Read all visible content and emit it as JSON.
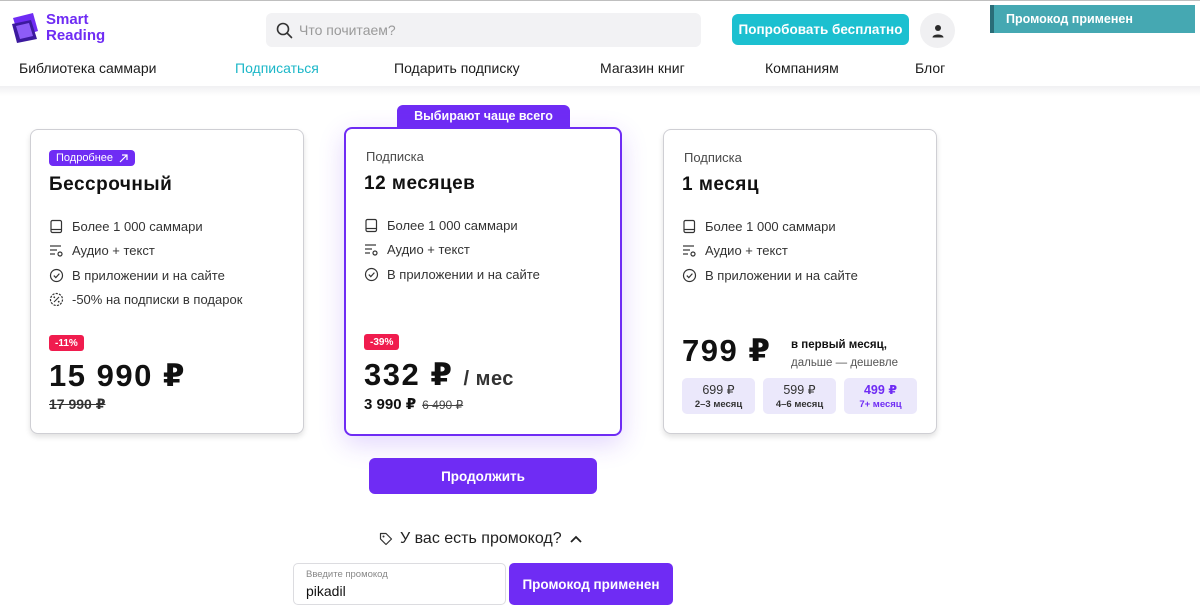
{
  "logo": {
    "line1": "Smart",
    "line2": "Reading"
  },
  "search": {
    "placeholder": "Что почитаем?",
    "icon": "search-icon"
  },
  "header": {
    "try_free_label": "Попробовать бесплатно",
    "user_icon": "user-icon"
  },
  "toast": {
    "text": "Промокод применен"
  },
  "nav": {
    "items": [
      {
        "label": "Библиотека саммари"
      },
      {
        "label": "Подписаться",
        "active": true
      },
      {
        "label": "Подарить подписку"
      },
      {
        "label": "Магазин книг"
      },
      {
        "label": "Компаниям"
      },
      {
        "label": "Блог"
      }
    ]
  },
  "plans": [
    {
      "tag": "Подробнее",
      "name": "Бессрочный",
      "features": [
        {
          "icon": "book-icon",
          "text": "Более 1 000 саммари"
        },
        {
          "icon": "audio-text-icon",
          "text": "Аудио + текст"
        },
        {
          "icon": "check-circle-icon",
          "text": "В приложении и на сайте"
        },
        {
          "icon": "discount-badge-icon",
          "text": "-50% на подписки в подарок"
        }
      ],
      "discount": "-11%",
      "price": "15 990 ₽",
      "old_price": "17 990 ₽"
    },
    {
      "badge": "Выбирают чаще всего",
      "kind": "Подписка",
      "name": "12 месяцев",
      "features": [
        {
          "icon": "book-icon",
          "text": "Более 1 000 саммари"
        },
        {
          "icon": "audio-text-icon",
          "text": "Аудио + текст"
        },
        {
          "icon": "check-circle-icon",
          "text": "В приложении и на сайте"
        }
      ],
      "discount": "-39%",
      "price": "332 ₽",
      "per": "/ мес",
      "total": "3 990 ₽",
      "old_total": "6 490 ₽"
    },
    {
      "kind": "Подписка",
      "name": "1 месяц",
      "features": [
        {
          "icon": "book-icon",
          "text": "Более 1 000 саммари"
        },
        {
          "icon": "audio-text-icon",
          "text": "Аудио + текст"
        },
        {
          "icon": "check-circle-icon",
          "text": "В приложении и на сайте"
        }
      ],
      "price": "799 ₽",
      "first_month_line1": "в первый месяц,",
      "first_month_line2": "дальше — дешевле",
      "tiers": [
        {
          "price": "699 ₽",
          "months": "2–3 месяц"
        },
        {
          "price": "599 ₽",
          "months": "4–6 месяц"
        },
        {
          "price": "499 ₽",
          "months": "7+ месяц",
          "highlight": true
        }
      ]
    }
  ],
  "continue_label": "Продолжить",
  "promo": {
    "toggle_label": "У вас есть промокод?",
    "field_label": "Введите промокод",
    "value": "pikadil",
    "button_label": "Промокод применен"
  },
  "colors": {
    "accent": "#6f2cf4",
    "teal": "#1cc0d0",
    "discount": "#f01c4e",
    "toast": "#45a8b2"
  }
}
